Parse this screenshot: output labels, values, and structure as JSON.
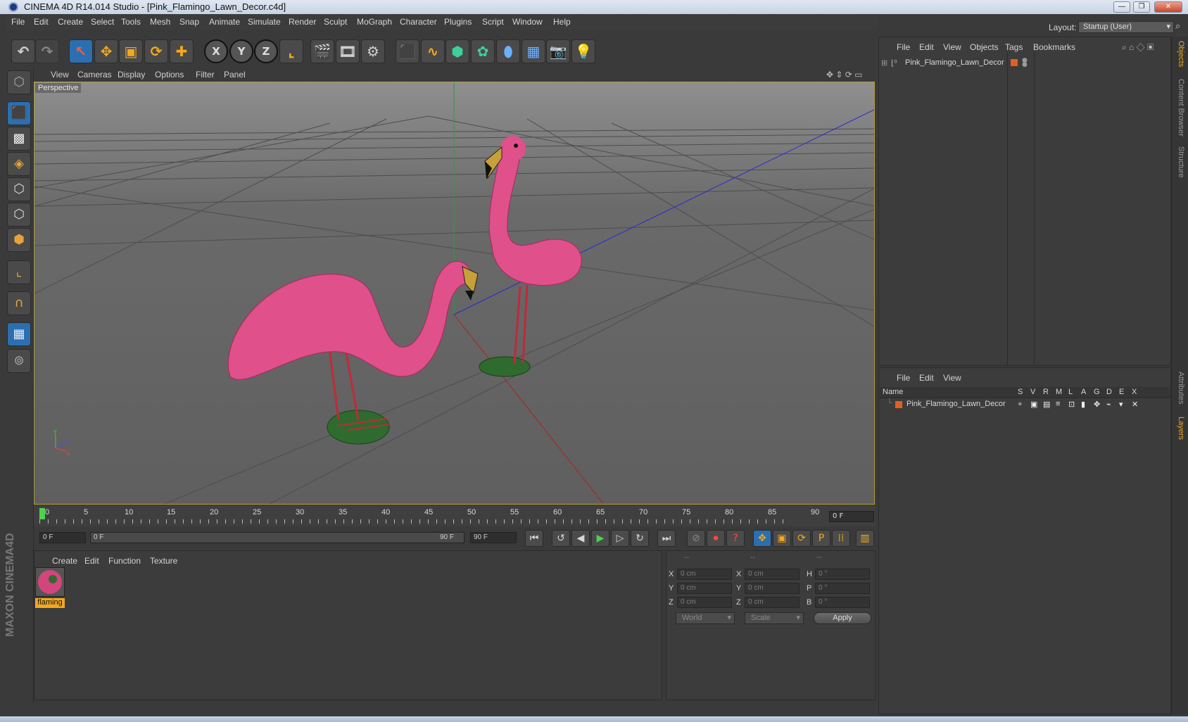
{
  "window": {
    "title": "CINEMA 4D R14.014 Studio - [Pink_Flamingo_Lawn_Decor.c4d]",
    "controls": {
      "minimize": "—",
      "restore": "❐",
      "close": "✕"
    }
  },
  "menubar": {
    "items": [
      "File",
      "Edit",
      "Create",
      "Select",
      "Tools",
      "Mesh",
      "Snap",
      "Animate",
      "Simulate",
      "Render",
      "Sculpt",
      "MoGraph",
      "Character",
      "Plugins",
      "Script",
      "Window",
      "Help"
    ],
    "layout_label": "Layout:",
    "layout_value": "Startup (User)"
  },
  "viewport": {
    "menu": [
      "View",
      "Cameras",
      "Display",
      "Options",
      "Filter",
      "Panel"
    ],
    "camera_label": "Perspective",
    "axis": {
      "y": "y",
      "z": "z",
      "x": "x"
    }
  },
  "timeline": {
    "ticks": [
      "0",
      "5",
      "10",
      "15",
      "20",
      "25",
      "30",
      "35",
      "40",
      "45",
      "50",
      "55",
      "60",
      "65",
      "70",
      "75",
      "80",
      "85",
      "90"
    ],
    "current_frame_field": "0 F",
    "start_field": "0 F",
    "range_start": "0 F",
    "range_end": "90 F",
    "end_field": "90 F"
  },
  "materials": {
    "menu": [
      "Create",
      "Edit",
      "Function",
      "Texture"
    ],
    "items": [
      {
        "label": "flaming"
      }
    ]
  },
  "coordinates": {
    "headers": [
      "--",
      "--",
      "--"
    ],
    "rows": [
      {
        "a": "X",
        "a_val": "0 cm",
        "b": "X",
        "b_val": "0 cm",
        "c": "H",
        "c_val": "0 °"
      },
      {
        "a": "Y",
        "a_val": "0 cm",
        "b": "Y",
        "b_val": "0 cm",
        "c": "P",
        "c_val": "0 °"
      },
      {
        "a": "Z",
        "a_val": "0 cm",
        "b": "Z",
        "b_val": "0 cm",
        "c": "B",
        "c_val": "0 °"
      }
    ],
    "world_dropdown": "World",
    "scale_dropdown": "Scale",
    "apply_label": "Apply"
  },
  "object_manager": {
    "menu": [
      "File",
      "Edit",
      "View",
      "Objects",
      "Tags",
      "Bookmarks"
    ],
    "objects": [
      {
        "name": "Pink_Flamingo_Lawn_Decor",
        "color": "#e06020"
      }
    ]
  },
  "layer_manager": {
    "menu": [
      "File",
      "Edit",
      "View"
    ],
    "columns": [
      "Name",
      "S",
      "V",
      "R",
      "M",
      "L",
      "A",
      "G",
      "D",
      "E",
      "X"
    ],
    "layers": [
      {
        "name": "Pink_Flamingo_Lawn_Decor",
        "color": "#e06020"
      }
    ]
  },
  "side_tabs": [
    "Objects",
    "Content Browser",
    "Structure",
    "Attributes",
    "Layers"
  ],
  "branding": {
    "logo_text": "MAXON CINEMA4D"
  },
  "colors": {
    "accent": "#f3a81d",
    "selection": "#2b6fb1",
    "flamingo": "#e0508a"
  }
}
